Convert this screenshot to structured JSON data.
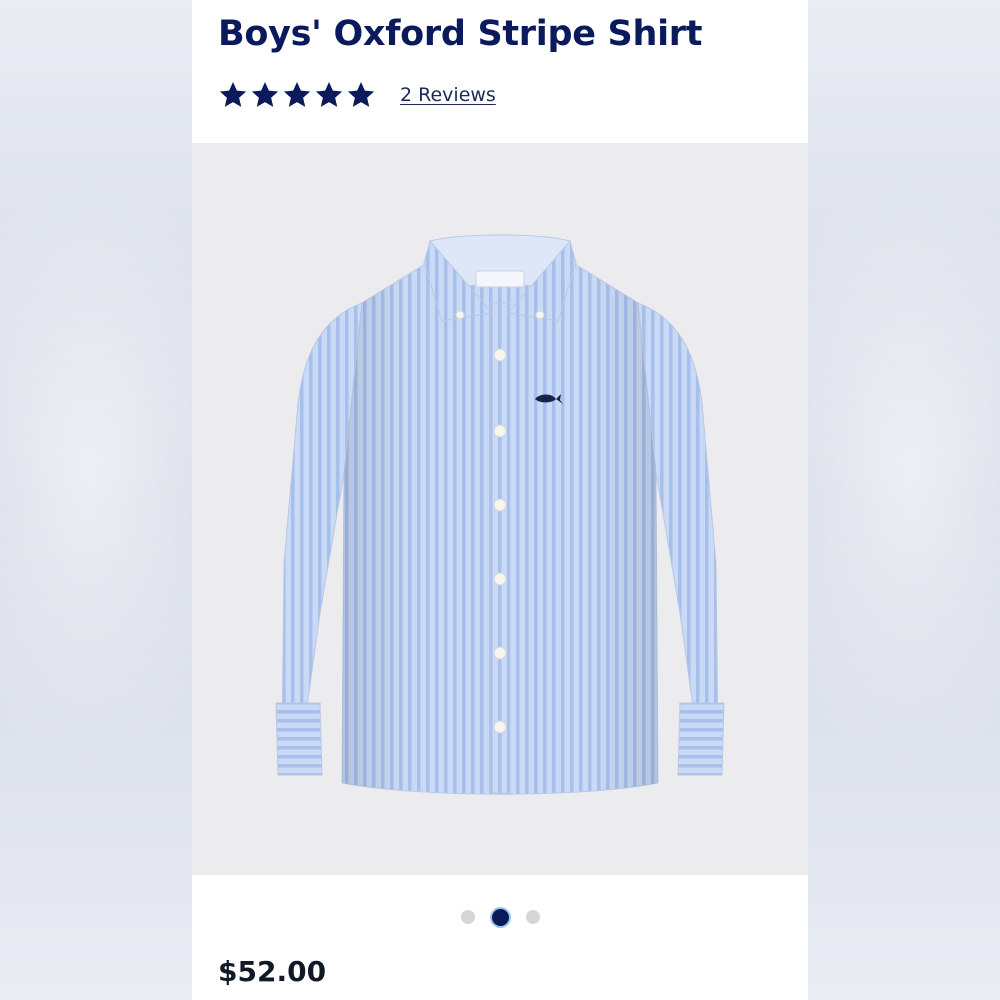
{
  "product": {
    "title": "Boys' Oxford Stripe Shirt",
    "rating": 5,
    "rating_max": 5,
    "reviews_label": "2 Reviews",
    "price": "$52.00",
    "image": {
      "icon": "oxford-stripe-shirt-photo",
      "shirt_color": "#c9d8f4",
      "stripe_color": "#a7c1ea",
      "logo_color": "#1a2150"
    },
    "gallery": {
      "total": 3,
      "active_index": 2
    }
  },
  "colors": {
    "brand_navy": "#0b1a5c",
    "star": "#0b1a5c",
    "dot_inactive": "#d4d6da",
    "dot_active": "#0b1a5c",
    "gallery_bg": "#ececef"
  },
  "icons": {
    "star": "star-icon"
  }
}
